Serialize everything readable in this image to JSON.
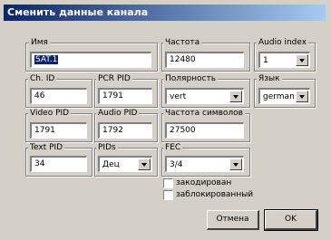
{
  "window": {
    "title": "Сменить данные канала"
  },
  "fields": {
    "name": {
      "label": "Имя",
      "value": "SAT.1"
    },
    "frequency": {
      "label": "Частота",
      "value": "12480"
    },
    "audio_index": {
      "label": "Audio index",
      "value": "1"
    },
    "ch_id": {
      "label": "Ch. ID",
      "value": "46"
    },
    "pcr_pid": {
      "label": "PCR PID",
      "value": "1791"
    },
    "polarity": {
      "label": "Полярность",
      "value": "vert"
    },
    "language": {
      "label": "Язык",
      "value": "german"
    },
    "video_pid": {
      "label": "Video PID",
      "value": "1791"
    },
    "audio_pid": {
      "label": "Audio PID",
      "value": "1792"
    },
    "symbol_rate": {
      "label": "Частота символов",
      "value": "27500"
    },
    "text_pid": {
      "label": "Text PID",
      "value": "34"
    },
    "pids": {
      "label": "PIDs",
      "value": "Дец"
    },
    "fec": {
      "label": "FEC",
      "value": "3/4"
    }
  },
  "checkboxes": {
    "encoded": {
      "label": "закодирован",
      "checked": false
    },
    "locked": {
      "label": "заблокированный",
      "checked": false
    }
  },
  "buttons": {
    "cancel": "Отмена",
    "ok": "OK"
  }
}
